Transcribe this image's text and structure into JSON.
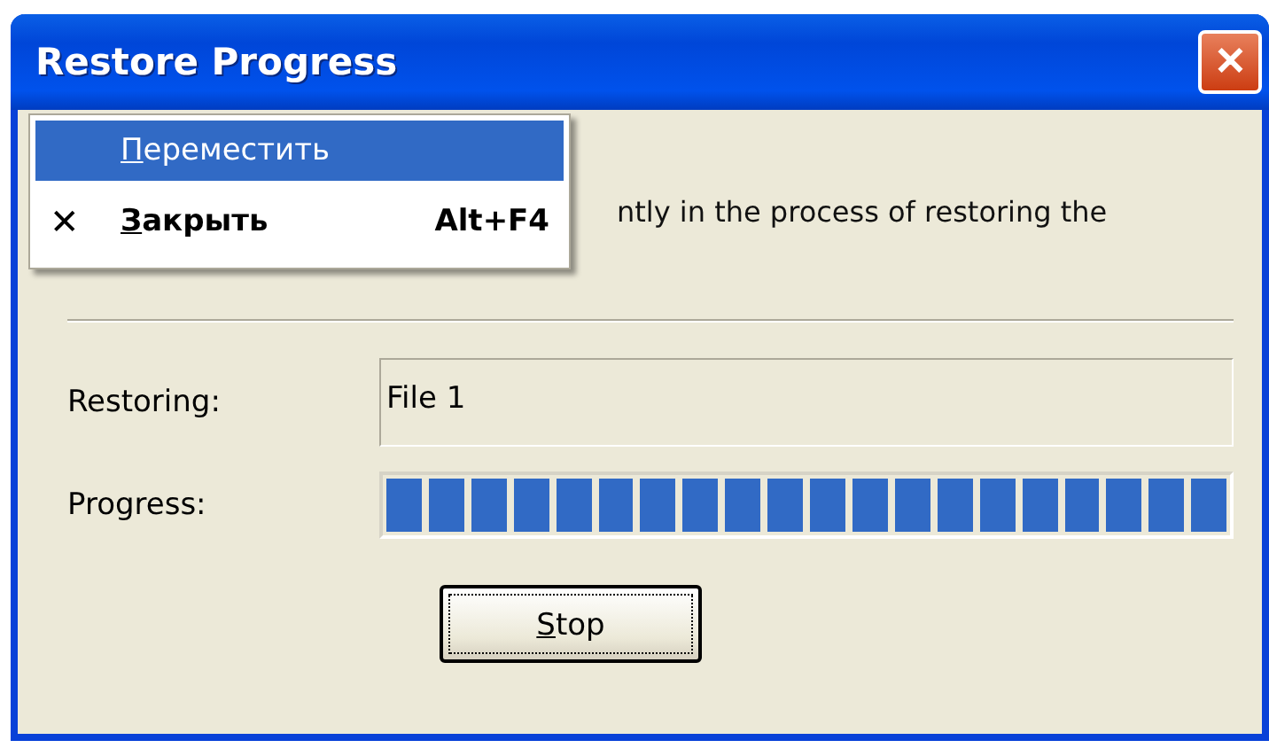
{
  "window": {
    "title": "Restore Progress",
    "close_glyph": "✕"
  },
  "menu": [
    {
      "label": "Переместить",
      "selected": true
    },
    {
      "label": "Закрыть",
      "selected": false,
      "icon": "✕",
      "shortcut": "Alt+F4"
    }
  ],
  "message": "ntly in the process of restoring the",
  "fields": [
    {
      "label": "Restoring:",
      "kind": "text",
      "value": "File 1"
    },
    {
      "label": "Progress:",
      "kind": "progress",
      "level": 1
    }
  ],
  "buttons": [
    {
      "label": "Stop"
    }
  ]
}
